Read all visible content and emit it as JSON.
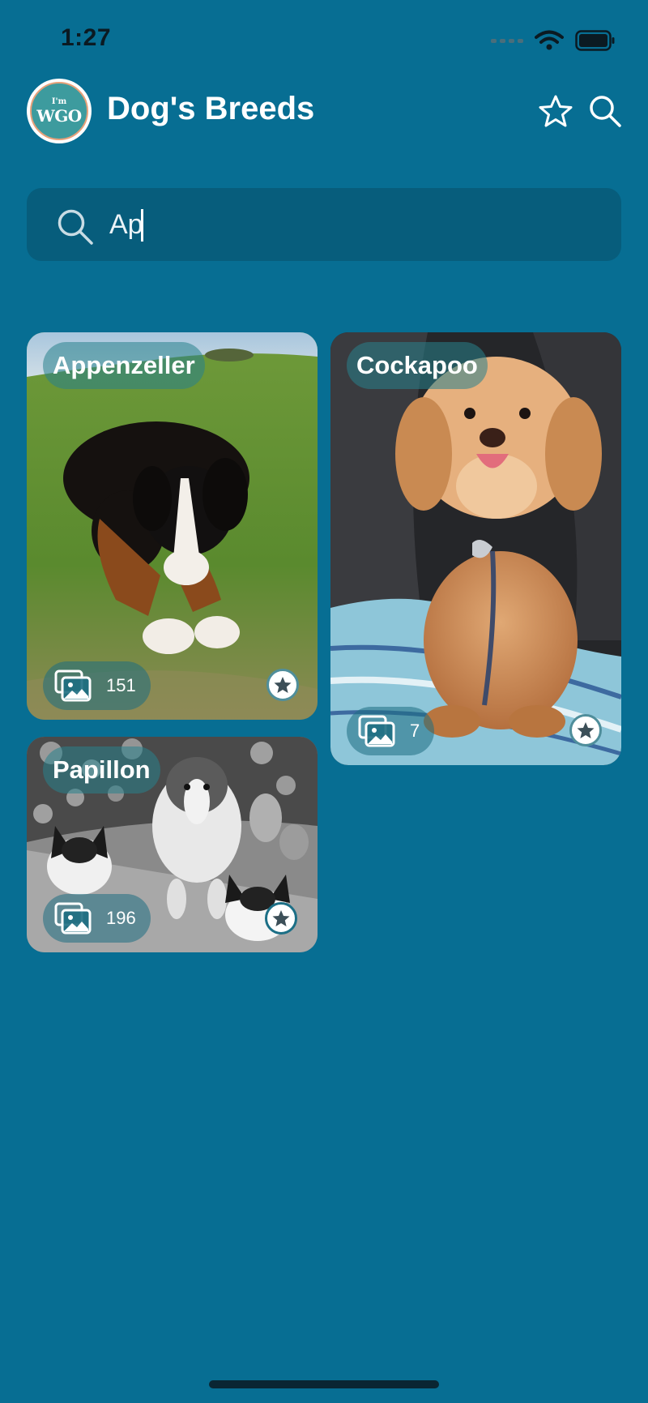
{
  "status_bar": {
    "time": "1:27"
  },
  "header": {
    "logo_top": "I'm",
    "logo_main": "WGO",
    "title": "Dog's Breeds",
    "favorites_icon": "star-outline-icon",
    "search_icon": "search-icon"
  },
  "search": {
    "value": "Ap"
  },
  "breeds": [
    {
      "name": "Appenzeller",
      "photo_count": "151"
    },
    {
      "name": "Cockapoo",
      "photo_count": "7"
    },
    {
      "name": "Papillon",
      "photo_count": "196"
    }
  ],
  "colors": {
    "background": "#076e93",
    "search_field": "#075d7c",
    "pill": "#2a8a96",
    "favorite_star": "#3c4f58"
  }
}
